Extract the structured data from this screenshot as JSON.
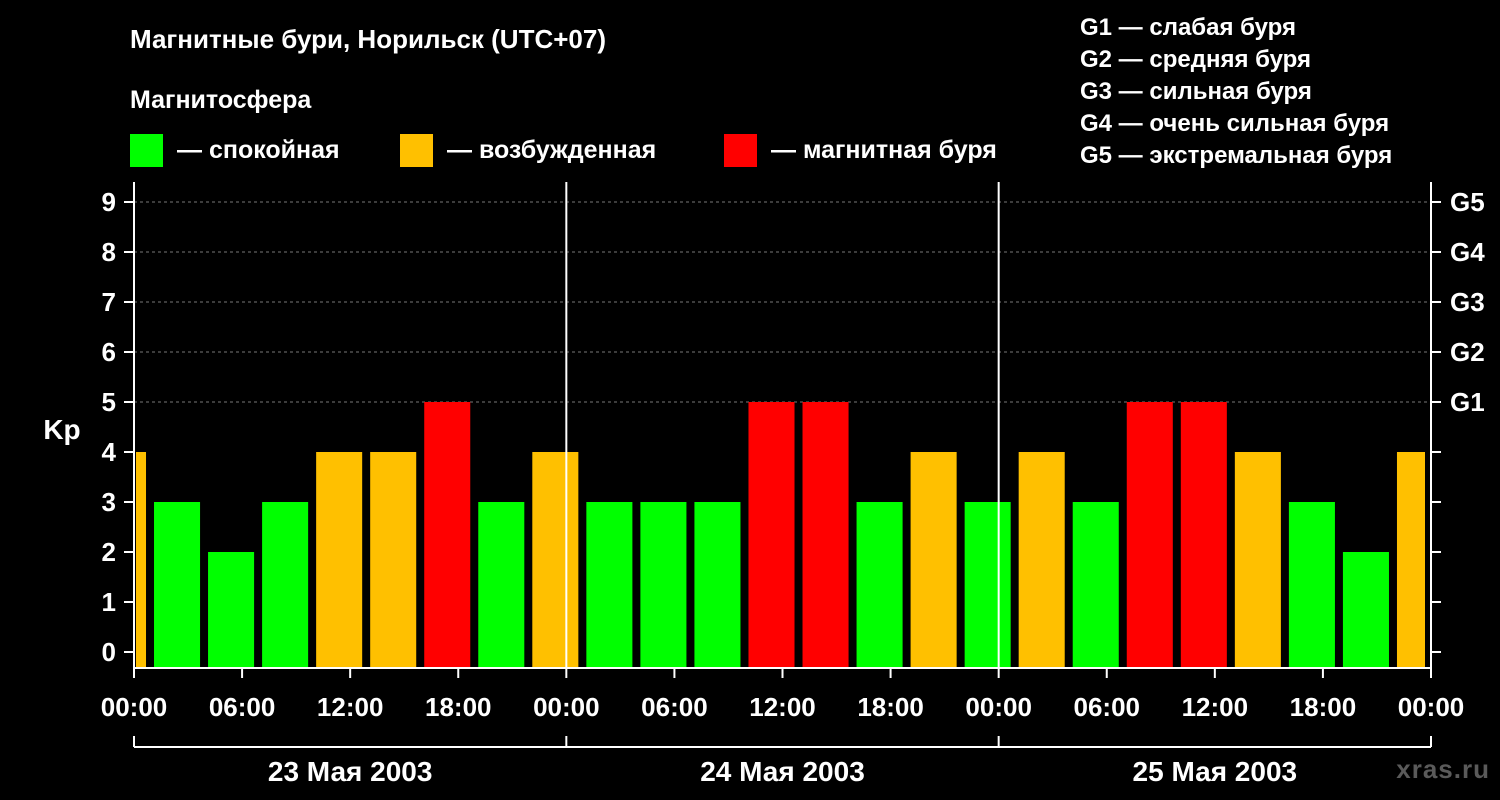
{
  "title": "Магнитные бури, Норильск (UTC+07)",
  "subtitle": "Магнитосфера",
  "legend": [
    {
      "label": "— спокойная",
      "color": "#00ff00"
    },
    {
      "label": "— возбужденная",
      "color": "#ffc000"
    },
    {
      "label": "— магнитная буря",
      "color": "#ff0000"
    }
  ],
  "g_scale": [
    "G1 — слабая буря",
    "G2 — средняя буря",
    "G3 — сильная буря",
    "G4 — очень сильная буря",
    "G5 — экстремальная буря"
  ],
  "watermark": "xras.ru",
  "chart_data": {
    "type": "bar",
    "ylabel": "Kp",
    "ylim": [
      0,
      9
    ],
    "y_ticks": [
      "0",
      "1",
      "2",
      "3",
      "4",
      "5",
      "6",
      "7",
      "8",
      "9"
    ],
    "right_ticks": [
      {
        "kp": 5,
        "label": "G1"
      },
      {
        "kp": 6,
        "label": "G2"
      },
      {
        "kp": 7,
        "label": "G3"
      },
      {
        "kp": 8,
        "label": "G4"
      },
      {
        "kp": 9,
        "label": "G5"
      }
    ],
    "x_ticks": [
      "00:00",
      "06:00",
      "12:00",
      "18:00",
      "00:00",
      "06:00",
      "12:00",
      "18:00",
      "00:00",
      "06:00",
      "12:00",
      "18:00",
      "00:00"
    ],
    "days": [
      "23 Мая 2003",
      "24 Мая 2003",
      "25 Мая 2003"
    ],
    "grid": true,
    "first_bar_hours": 1,
    "interval_hours": 3,
    "values": [
      4,
      3,
      2,
      3,
      4,
      4,
      5,
      3,
      4,
      3,
      3,
      3,
      5,
      5,
      3,
      4,
      3,
      4,
      3,
      5,
      5,
      4,
      3,
      2,
      4
    ],
    "level_colors": {
      "quiet": "#00ff00",
      "active": "#ffc000",
      "storm": "#ff0000"
    },
    "thresholds": {
      "active_from": 4,
      "storm_from": 5
    }
  }
}
